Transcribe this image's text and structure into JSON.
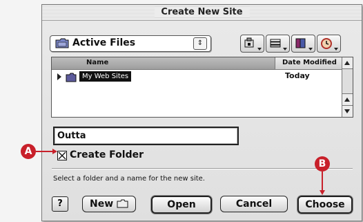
{
  "dialog": {
    "title": "Create New Site",
    "location_popup": {
      "value": "Active Files"
    },
    "toolbar": {
      "icons": [
        "network-folder-icon",
        "stack-icon",
        "book-icon",
        "clock-icon"
      ]
    },
    "file_list": {
      "columns": [
        "Name",
        "Date Modified"
      ],
      "rows": [
        {
          "name": "My Web Sites",
          "date_modified": "Today",
          "selected": true
        }
      ]
    },
    "site_name_field": {
      "value": "Outta"
    },
    "create_folder_checkbox": {
      "label": "Create Folder",
      "checked": true
    },
    "hint": "Select a folder and a name for the new site.",
    "buttons": {
      "help": "?",
      "new_folder": "New",
      "open": "Open",
      "cancel": "Cancel",
      "choose": "Choose"
    }
  },
  "callouts": {
    "a": "A",
    "b": "B",
    "color": "#c8202a"
  }
}
